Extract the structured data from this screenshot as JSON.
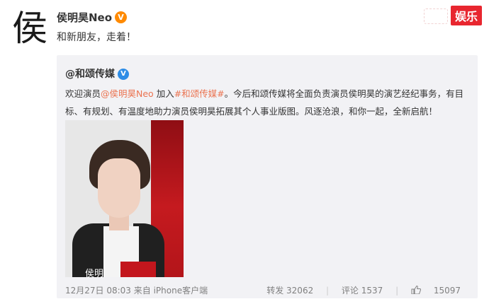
{
  "post": {
    "avatar_char": "侯",
    "username": "侯明昊Neo",
    "verified_icon": "v-badge-orange",
    "text": "和新朋友，走着！"
  },
  "watermark": {
    "label": "娱乐",
    "color": "#e8262f"
  },
  "repost": {
    "author": "@和颂传媒",
    "verified_icon": "v-badge-blue",
    "text_part1": "欢迎演员",
    "mention": "@侯明昊Neo",
    "text_part2": " 加入",
    "hashtag": "#和颂传媒#",
    "text_part3": "。今后和颂传媒将全面负责演员侯明昊的演艺经纪事务，有目标、有规划、有温度地助力演员侯明昊拓展其个人事业版图。风逐沧浪，和你一起，全新启航！",
    "photo": {
      "caption": "侯明"
    },
    "footer": {
      "time": "12月27日 08:03 来自 iPhone客户端",
      "repost_label": "转发 32062",
      "comment_label": "评论 1537",
      "like_count": "15097",
      "separator": "|"
    }
  },
  "colors": {
    "link": "#eb7350",
    "verified_orange": "#ff8a00",
    "verified_blue": "#2e8de6"
  }
}
